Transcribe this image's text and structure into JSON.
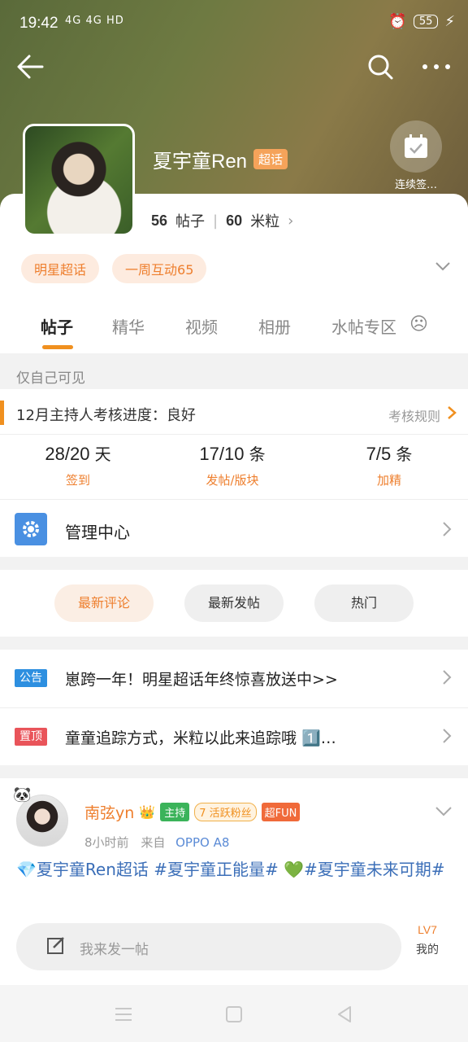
{
  "status_bar": {
    "time": "19:42",
    "network": "4G  4G  HD",
    "battery": "55"
  },
  "header": {
    "topic_name": "夏宇童Ren",
    "super_badge": "超话",
    "checkin_label": "连续签…"
  },
  "stats": {
    "posts_count": "56",
    "posts_label": "帖子",
    "rice_count": "60",
    "rice_label": "米粒"
  },
  "tags": [
    "明星超话",
    "一周互动65"
  ],
  "tabs": [
    {
      "label": "帖子",
      "active": true
    },
    {
      "label": "精华",
      "active": false
    },
    {
      "label": "视频",
      "active": false
    },
    {
      "label": "相册",
      "active": false
    },
    {
      "label": "水帖专区",
      "active": false
    }
  ],
  "visibility_note": "仅自己可见",
  "assessment": {
    "title": "12月主持人考核进度：良好",
    "rules_link": "考核规则",
    "items": [
      {
        "value": "28/20",
        "unit": "天",
        "label": "签到"
      },
      {
        "value": "17/10",
        "unit": "条",
        "label": "发帖/版块"
      },
      {
        "value": "7/5",
        "unit": "条",
        "label": "加精"
      }
    ]
  },
  "manage_center": "管理中心",
  "sort_buttons": [
    {
      "label": "最新评论",
      "active": true
    },
    {
      "label": "最新发帖",
      "active": false
    },
    {
      "label": "热门",
      "active": false
    }
  ],
  "announcements": [
    {
      "badge": "公告",
      "badge_color": "#2d8fe0",
      "text": "崽跨一年！明星超话年终惊喜放送中>>"
    },
    {
      "badge": "置顶",
      "badge_color": "#e9545a",
      "text": "童童追踪方式，米粒以此来追踪哦 1️⃣…"
    }
  ],
  "post": {
    "author": "南弦yn",
    "badge_host": "主持",
    "badge_fan": "7 活跃粉丝",
    "badge_fun": "超FUN",
    "time": "8小时前",
    "from_label": "来自",
    "device": "OPPO A8",
    "body": "💎夏宇童Ren超话 #夏宇童正能量# 💚#夏宇童未来可期#"
  },
  "composer": {
    "placeholder": "我来发一帖",
    "mine_level": "LV7",
    "mine_label": "我的"
  }
}
